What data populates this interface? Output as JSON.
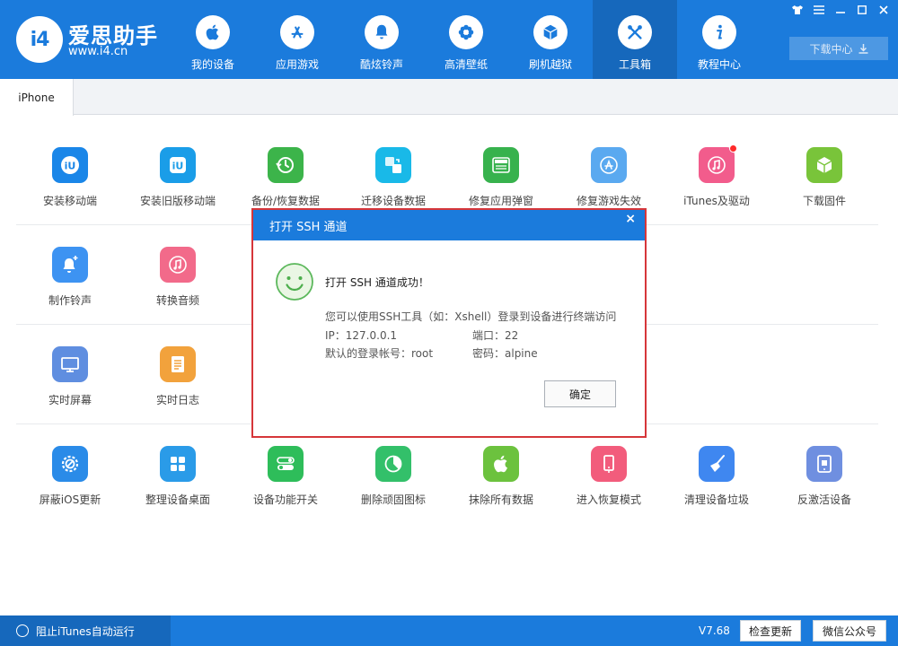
{
  "brand": {
    "name": "爱思助手",
    "url": "www.i4.cn",
    "logo_text": "i4"
  },
  "nav": [
    {
      "label": "我的设备",
      "icon": "apple-icon"
    },
    {
      "label": "应用游戏",
      "icon": "app-store-icon"
    },
    {
      "label": "酷炫铃声",
      "icon": "bell-icon"
    },
    {
      "label": "高清壁纸",
      "icon": "flower-icon"
    },
    {
      "label": "刷机越狱",
      "icon": "box-icon"
    },
    {
      "label": "工具箱",
      "icon": "tools-icon",
      "active": true
    },
    {
      "label": "教程中心",
      "icon": "info-icon"
    }
  ],
  "window_controls": [
    "shirt-icon",
    "menu-icon",
    "minimize-icon",
    "maximize-icon",
    "close-icon"
  ],
  "download_center": "下载中心",
  "tabs": [
    {
      "label": "iPhone"
    }
  ],
  "tools": {
    "row1": [
      {
        "label": "安装移动端",
        "color": "#1a86e8"
      },
      {
        "label": "安装旧版移动端",
        "color": "#1a9de8"
      },
      {
        "label": "备份/恢复数据",
        "color": "#3cb44a"
      },
      {
        "label": "迁移设备数据",
        "color": "#19b9e8"
      },
      {
        "label": "修复应用弹窗",
        "color": "#37b24d"
      },
      {
        "label": "修复游戏失效",
        "color": "#5aa9f0"
      },
      {
        "label": "iTunes及驱动",
        "color": "#f25c8c"
      },
      {
        "label": "下载固件",
        "color": "#79c43a"
      }
    ],
    "row2": [
      {
        "label": "制作铃声",
        "color": "#3d93f2"
      },
      {
        "label": "转换音频",
        "color": "#f26a8a"
      }
    ],
    "row3": [
      {
        "label": "实时屏幕",
        "color": "#5f8ee0"
      },
      {
        "label": "实时日志",
        "color": "#f2a23c"
      }
    ],
    "row4": [
      {
        "label": "屏蔽iOS更新",
        "color": "#2a8be8"
      },
      {
        "label": "整理设备桌面",
        "color": "#2a9be8"
      },
      {
        "label": "设备功能开关",
        "color": "#2ebd5a"
      },
      {
        "label": "删除顽固图标",
        "color": "#33c06a"
      },
      {
        "label": "抹除所有数据",
        "color": "#6cc23e"
      },
      {
        "label": "进入恢复模式",
        "color": "#f25c7c"
      },
      {
        "label": "清理设备垃圾",
        "color": "#3f87f0"
      },
      {
        "label": "反激活设备",
        "color": "#6f8fe0"
      }
    ]
  },
  "dialog": {
    "title": "打开 SSH 通道",
    "close": "×",
    "success": "打开 SSH 通道成功！",
    "description": "您可以使用SSH工具（如：Xshell）登录到设备进行终端访问",
    "ip_label": "IP：127.0.0.1",
    "port_label": "端口：22",
    "account_label": "默认的登录帐号：root",
    "password_label": "密码：alpine",
    "ok": "确定"
  },
  "footer": {
    "block_itunes": "阻止iTunes自动运行",
    "version": "V7.68",
    "check_update": "检查更新",
    "wechat": "微信公众号"
  },
  "colors": {
    "primary": "#1b7bdc",
    "primary_dark": "#1668bc",
    "dialog_border": "#d6363a"
  }
}
